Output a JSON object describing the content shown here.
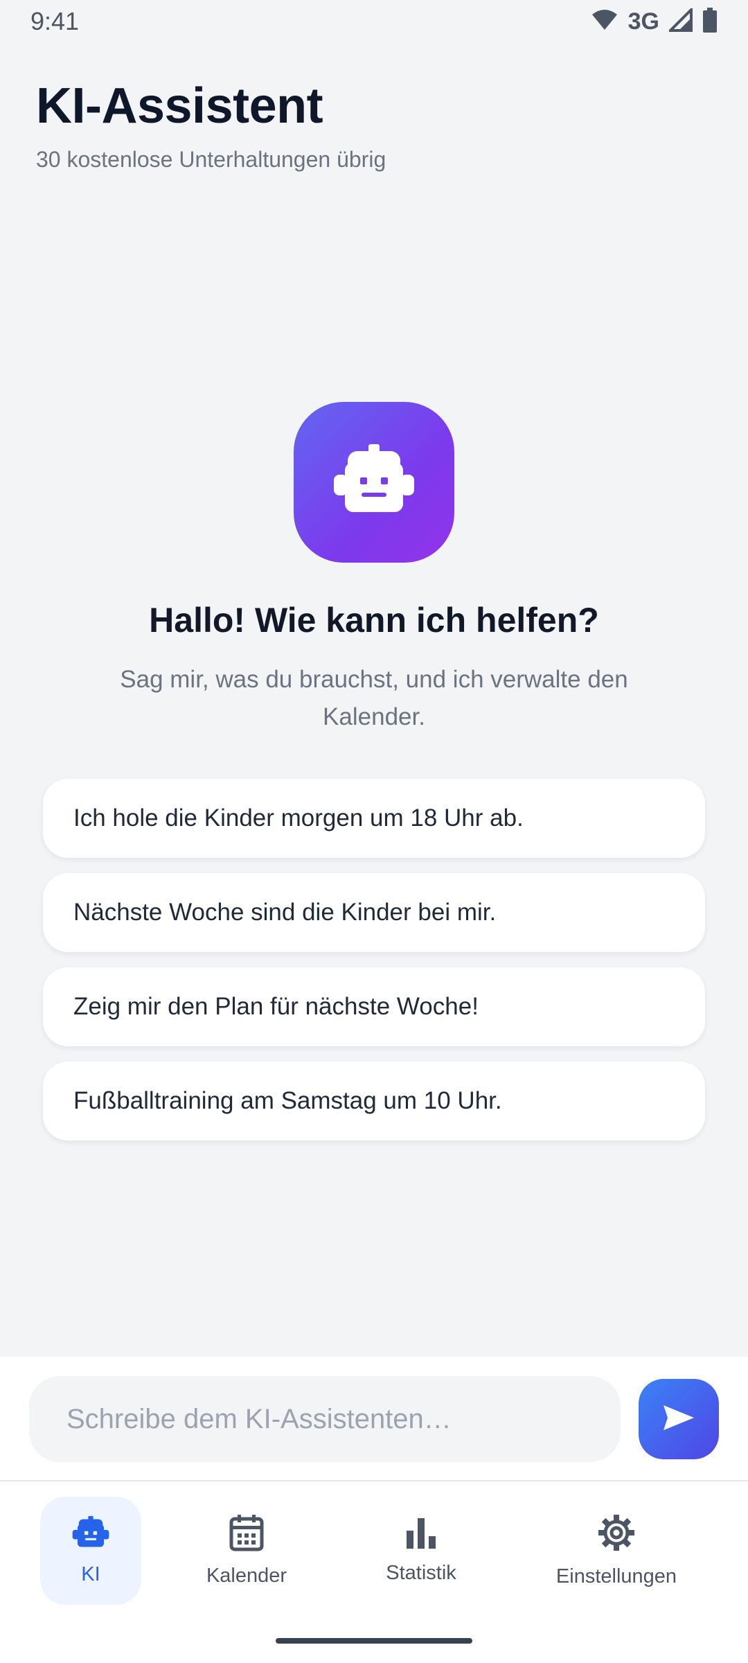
{
  "status_bar": {
    "time": "9:41",
    "network": "3G",
    "icons": [
      "wifi-icon",
      "signal-icon",
      "battery-icon"
    ]
  },
  "header": {
    "title": "KI-Assistent",
    "subtitle": "30 kostenlose Unterhaltungen übrig"
  },
  "hero": {
    "icon": "robot-icon",
    "greeting": "Hallo! Wie kann ich helfen?",
    "description": "Sag mir, was du brauchst, und ich verwalte den Kalender."
  },
  "suggestions": [
    "Ich hole die Kinder morgen um 18 Uhr ab.",
    "Nächste Woche sind die Kinder bei mir.",
    "Zeig mir den Plan für nächste Woche!",
    "Fußballtraining am Samstag um 10 Uhr."
  ],
  "composer": {
    "placeholder": "Schreibe dem KI-Assistenten…",
    "value": "",
    "send_icon": "send-icon"
  },
  "bottom_nav": {
    "items": [
      {
        "label": "KI",
        "icon": "robot-icon",
        "active": true
      },
      {
        "label": "Kalender",
        "icon": "calendar-icon",
        "active": false
      },
      {
        "label": "Statistik",
        "icon": "bar-chart-icon",
        "active": false
      },
      {
        "label": "Einstellungen",
        "icon": "gear-icon",
        "active": false
      }
    ]
  },
  "colors": {
    "accent": "#2563eb",
    "gradient_start": "#6366f1",
    "gradient_end": "#9333ea",
    "background": "#f3f4f6"
  }
}
